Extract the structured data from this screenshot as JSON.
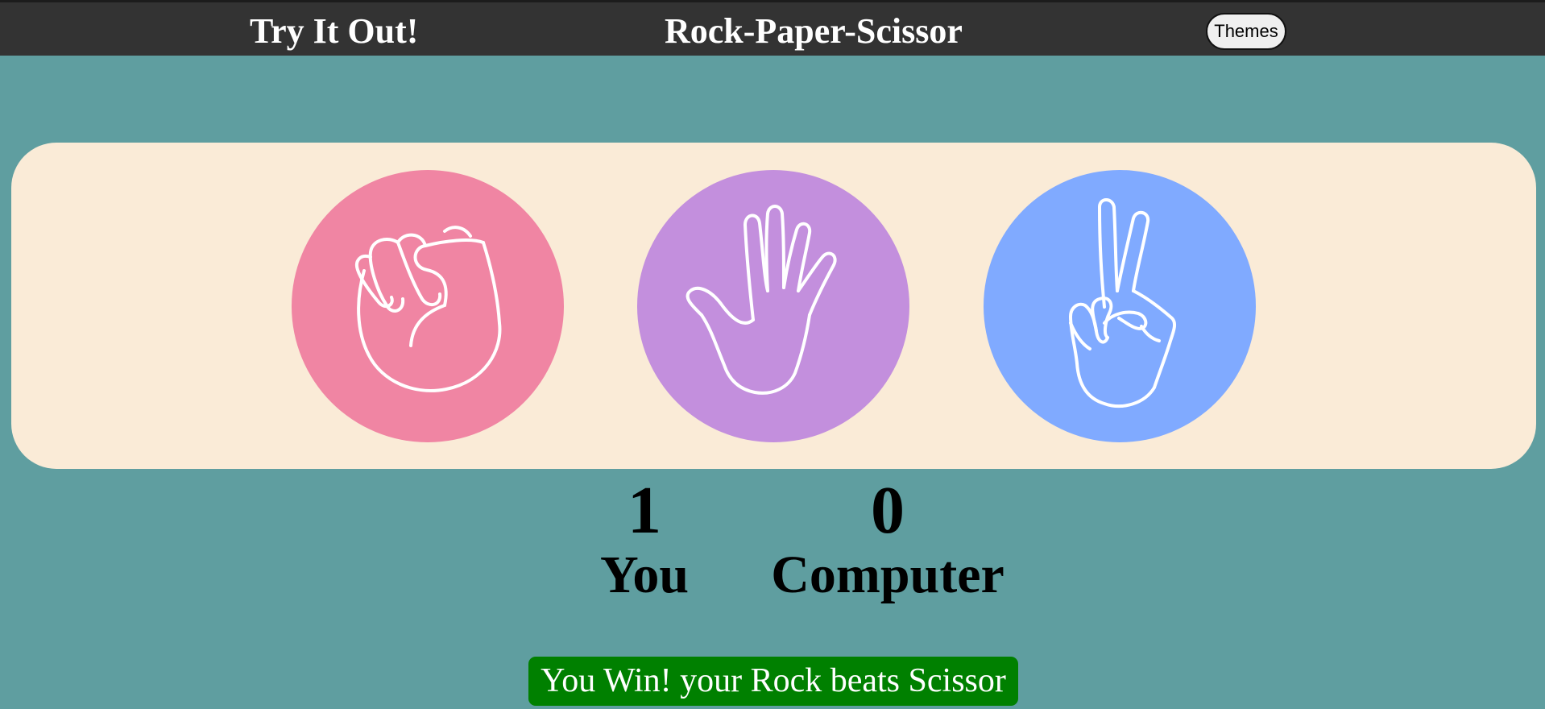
{
  "header": {
    "link_label": "Try It Out!",
    "title": "Rock-Paper-Scissor",
    "themes_label": "Themes",
    "background_color": "#333333",
    "text_color": "#ffffff"
  },
  "board": {
    "background_color": "#faebd7",
    "choices": [
      {
        "name": "Rock",
        "icon": "fist-icon",
        "color": "#f085a3"
      },
      {
        "name": "Paper",
        "icon": "open-hand-icon",
        "color": "#c38fdd"
      },
      {
        "name": "Scissor",
        "icon": "peace-hand-icon",
        "color": "#80aaff"
      }
    ]
  },
  "scores": {
    "user": {
      "value": "1",
      "label": "You"
    },
    "computer": {
      "value": "0",
      "label": "Computer"
    }
  },
  "result": {
    "message": "You Win! your Rock beats Scissor",
    "color": "#008000"
  },
  "page": {
    "background_color": "#5f9ea0"
  }
}
